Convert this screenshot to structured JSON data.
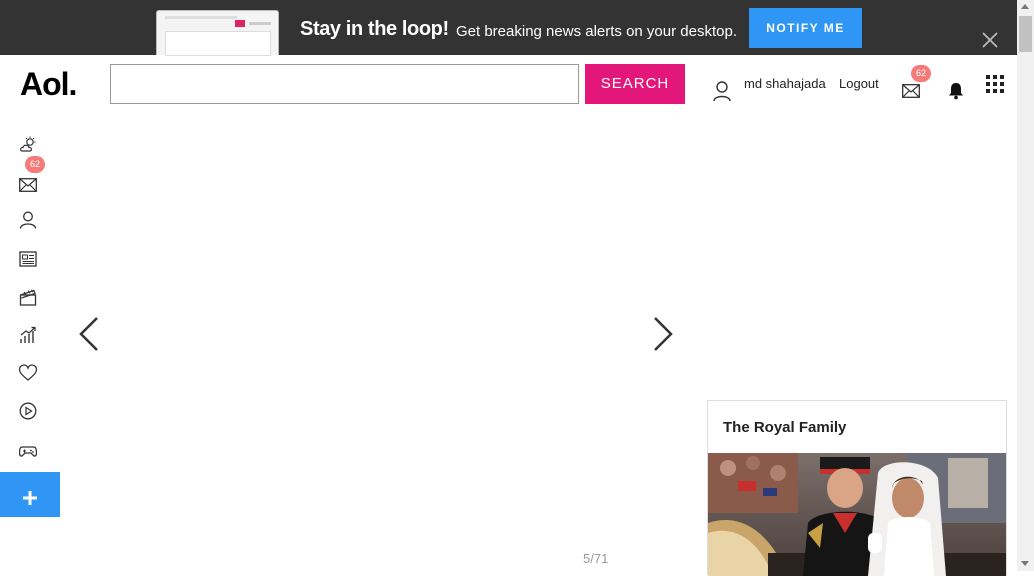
{
  "banner": {
    "title": "Stay in the loop!",
    "subtitle": "Get breaking news alerts on your desktop.",
    "notify_label": "NOTIFY ME"
  },
  "header": {
    "logo": "Aol.",
    "search_placeholder": "",
    "search_label": "SEARCH",
    "username": "md shahajada",
    "logout_label": "Logout",
    "mail_badge": "62"
  },
  "sidebar": {
    "items": [
      {
        "icon": "weather-icon"
      },
      {
        "icon": "mail-icon",
        "badge": "62"
      },
      {
        "icon": "profile-icon"
      },
      {
        "icon": "news-icon"
      },
      {
        "icon": "entertainment-icon"
      },
      {
        "icon": "finance-icon"
      },
      {
        "icon": "lifestyle-icon"
      },
      {
        "icon": "video-icon"
      },
      {
        "icon": "games-icon"
      }
    ],
    "more_icon": "plus-icon"
  },
  "slideshow": {
    "counter": "5/71"
  },
  "card": {
    "title": "The Royal Family"
  },
  "colors": {
    "banner_bg": "#333333",
    "notify_blue": "#2f96f5",
    "search_pink": "#e3177a",
    "badge_red": "#f57b7b"
  }
}
